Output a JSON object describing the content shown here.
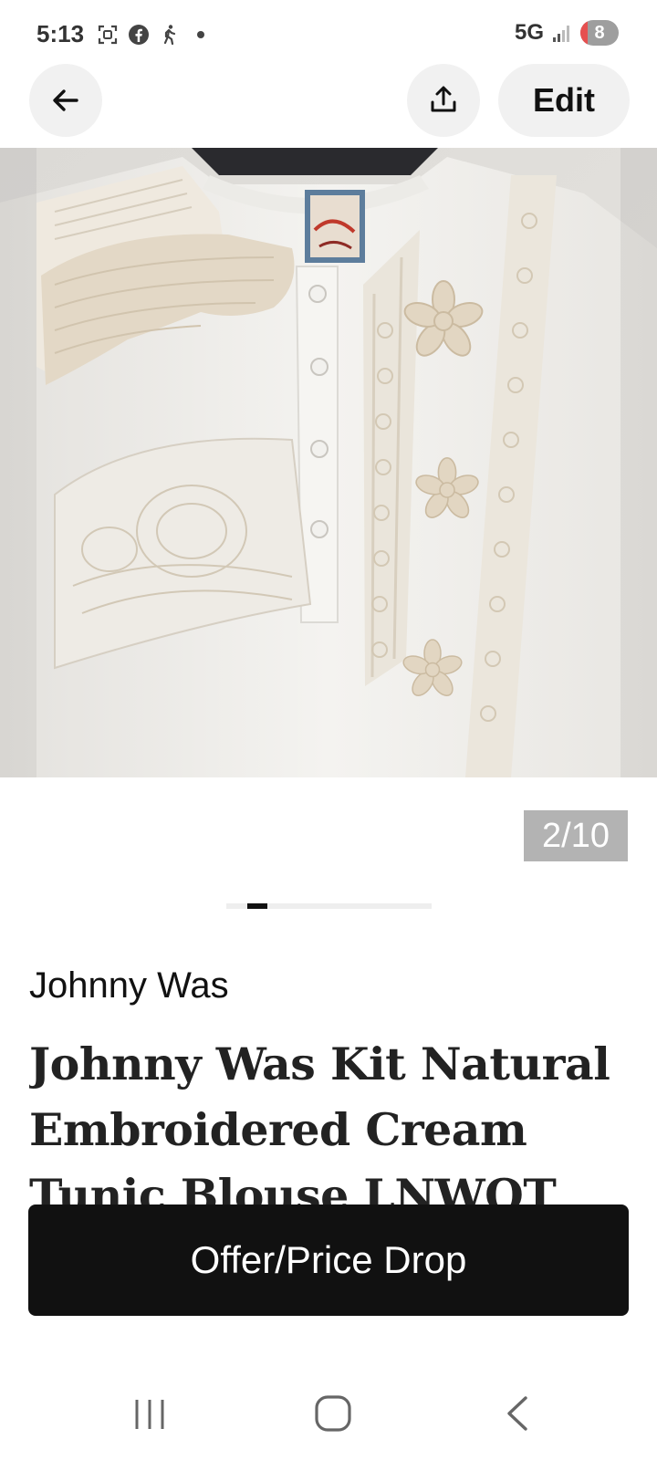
{
  "status_bar": {
    "time": "5:13",
    "network": "5G",
    "battery": "8",
    "icons": [
      "screenshot-icon",
      "facebook-icon",
      "walking-icon",
      "dot-icon",
      "signal-icon"
    ]
  },
  "header": {
    "back_icon": "arrow-left-icon",
    "share_icon": "share-upload-icon",
    "edit_label": "Edit"
  },
  "gallery": {
    "current_label": "2/10",
    "current_index": 2,
    "total": 10
  },
  "listing": {
    "brand": "Johnny Was",
    "title": "Johnny Was Kit Natural Embroidered Cream Tunic Blouse LNWOT SzL"
  },
  "actions": {
    "offer_label": "Offer/Price Drop"
  },
  "system_nav": {
    "icons": [
      "recent-apps-icon",
      "home-icon",
      "back-chevron-icon"
    ]
  },
  "colors": {
    "button_bg": "#111111",
    "pill_bg": "#f1f1f1",
    "counter_bg": "#b3b3b3"
  }
}
